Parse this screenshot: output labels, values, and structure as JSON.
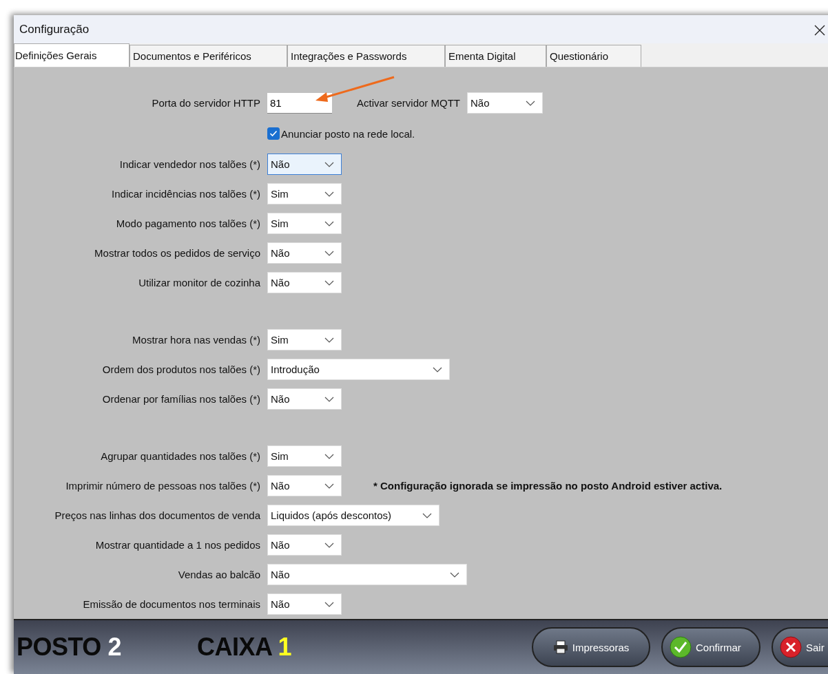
{
  "window": {
    "title": "Configuração"
  },
  "tabs": [
    {
      "label": "Definições Gerais",
      "selected": true
    },
    {
      "label": "Documentos e Periféricos",
      "selected": false
    },
    {
      "label": "Integrações e Passwords",
      "selected": false
    },
    {
      "label": "Ementa Digital",
      "selected": false
    },
    {
      "label": "Questionário",
      "selected": false
    }
  ],
  "server": {
    "label": "Porta do servidor HTTP",
    "value": "81",
    "mqtt_label": "Activar servidor MQTT",
    "mqtt_value": "Não"
  },
  "announce": {
    "label": "Anunciar posto na rede local.",
    "checked": true
  },
  "groups": [
    {
      "rows": [
        {
          "label": "Indicar vendedor nos talões (*)",
          "value": "Não",
          "kind": "small",
          "focused": true
        },
        {
          "label": "Indicar incidências nos talões (*)",
          "value": "Sim",
          "kind": "small",
          "focused": false
        },
        {
          "label": "Modo pagamento nos talões (*)",
          "value": "Sim",
          "kind": "small",
          "focused": false
        },
        {
          "label": "Mostrar todos os pedidos de serviço",
          "value": "Não",
          "kind": "small",
          "focused": false
        },
        {
          "label": "Utilizar monitor de cozinha",
          "value": "Não",
          "kind": "small",
          "focused": false
        }
      ]
    },
    {
      "rows": [
        {
          "label": "Mostrar hora nas vendas (*)",
          "value": "Sim",
          "kind": "small",
          "focused": false
        },
        {
          "label": "Ordem dos produtos nos talões (*)",
          "value": "Introdução",
          "kind": "large",
          "focused": false
        },
        {
          "label": "Ordenar por famílias nos talões (*)",
          "value": "Não",
          "kind": "small",
          "focused": false
        }
      ]
    },
    {
      "rows": [
        {
          "label": "Agrupar quantidades nos talões (*)",
          "value": "Sim",
          "kind": "small",
          "focused": false
        },
        {
          "label": "Imprimir número de pessoas nos talões (*)",
          "value": "Não",
          "kind": "small",
          "focused": false,
          "note": "* Configuração ignorada se impressão no posto Android estiver activa."
        },
        {
          "label": "Preços nas linhas dos documentos de venda",
          "value": "Liquidos (após descontos)",
          "kind": "medium",
          "focused": false
        },
        {
          "label": "Mostrar quantidade a 1 nos pedidos",
          "value": "Não",
          "kind": "small",
          "focused": false
        },
        {
          "label": "Vendas ao balcão",
          "value": "Não",
          "kind": "xlarge",
          "focused": false
        },
        {
          "label": "Emissão de documentos nos terminais",
          "value": "Não",
          "kind": "small",
          "focused": false
        }
      ]
    }
  ],
  "footer": {
    "posto_label": "POSTO",
    "posto_number": "2",
    "caixa_label": "CAIXA",
    "caixa_number": "1",
    "buttons": [
      {
        "kind": "printer",
        "label": "Impressoras"
      },
      {
        "kind": "confirm",
        "label": "Confirmar"
      },
      {
        "kind": "exit",
        "label": "Sair"
      }
    ]
  }
}
